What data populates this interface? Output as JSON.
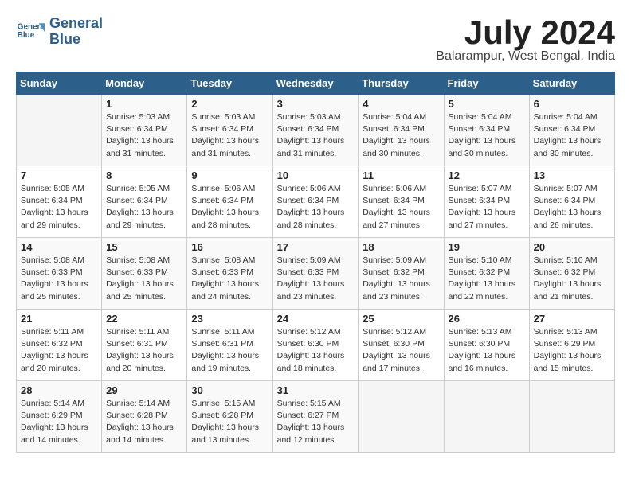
{
  "header": {
    "logo_line1": "General",
    "logo_line2": "Blue",
    "title": "July 2024",
    "location": "Balarampur, West Bengal, India"
  },
  "days_of_week": [
    "Sunday",
    "Monday",
    "Tuesday",
    "Wednesday",
    "Thursday",
    "Friday",
    "Saturday"
  ],
  "weeks": [
    [
      {
        "num": "",
        "info": ""
      },
      {
        "num": "1",
        "info": "Sunrise: 5:03 AM\nSunset: 6:34 PM\nDaylight: 13 hours\nand 31 minutes."
      },
      {
        "num": "2",
        "info": "Sunrise: 5:03 AM\nSunset: 6:34 PM\nDaylight: 13 hours\nand 31 minutes."
      },
      {
        "num": "3",
        "info": "Sunrise: 5:03 AM\nSunset: 6:34 PM\nDaylight: 13 hours\nand 31 minutes."
      },
      {
        "num": "4",
        "info": "Sunrise: 5:04 AM\nSunset: 6:34 PM\nDaylight: 13 hours\nand 30 minutes."
      },
      {
        "num": "5",
        "info": "Sunrise: 5:04 AM\nSunset: 6:34 PM\nDaylight: 13 hours\nand 30 minutes."
      },
      {
        "num": "6",
        "info": "Sunrise: 5:04 AM\nSunset: 6:34 PM\nDaylight: 13 hours\nand 30 minutes."
      }
    ],
    [
      {
        "num": "7",
        "info": "Sunrise: 5:05 AM\nSunset: 6:34 PM\nDaylight: 13 hours\nand 29 minutes."
      },
      {
        "num": "8",
        "info": "Sunrise: 5:05 AM\nSunset: 6:34 PM\nDaylight: 13 hours\nand 29 minutes."
      },
      {
        "num": "9",
        "info": "Sunrise: 5:06 AM\nSunset: 6:34 PM\nDaylight: 13 hours\nand 28 minutes."
      },
      {
        "num": "10",
        "info": "Sunrise: 5:06 AM\nSunset: 6:34 PM\nDaylight: 13 hours\nand 28 minutes."
      },
      {
        "num": "11",
        "info": "Sunrise: 5:06 AM\nSunset: 6:34 PM\nDaylight: 13 hours\nand 27 minutes."
      },
      {
        "num": "12",
        "info": "Sunrise: 5:07 AM\nSunset: 6:34 PM\nDaylight: 13 hours\nand 27 minutes."
      },
      {
        "num": "13",
        "info": "Sunrise: 5:07 AM\nSunset: 6:34 PM\nDaylight: 13 hours\nand 26 minutes."
      }
    ],
    [
      {
        "num": "14",
        "info": "Sunrise: 5:08 AM\nSunset: 6:33 PM\nDaylight: 13 hours\nand 25 minutes."
      },
      {
        "num": "15",
        "info": "Sunrise: 5:08 AM\nSunset: 6:33 PM\nDaylight: 13 hours\nand 25 minutes."
      },
      {
        "num": "16",
        "info": "Sunrise: 5:08 AM\nSunset: 6:33 PM\nDaylight: 13 hours\nand 24 minutes."
      },
      {
        "num": "17",
        "info": "Sunrise: 5:09 AM\nSunset: 6:33 PM\nDaylight: 13 hours\nand 23 minutes."
      },
      {
        "num": "18",
        "info": "Sunrise: 5:09 AM\nSunset: 6:32 PM\nDaylight: 13 hours\nand 23 minutes."
      },
      {
        "num": "19",
        "info": "Sunrise: 5:10 AM\nSunset: 6:32 PM\nDaylight: 13 hours\nand 22 minutes."
      },
      {
        "num": "20",
        "info": "Sunrise: 5:10 AM\nSunset: 6:32 PM\nDaylight: 13 hours\nand 21 minutes."
      }
    ],
    [
      {
        "num": "21",
        "info": "Sunrise: 5:11 AM\nSunset: 6:32 PM\nDaylight: 13 hours\nand 20 minutes."
      },
      {
        "num": "22",
        "info": "Sunrise: 5:11 AM\nSunset: 6:31 PM\nDaylight: 13 hours\nand 20 minutes."
      },
      {
        "num": "23",
        "info": "Sunrise: 5:11 AM\nSunset: 6:31 PM\nDaylight: 13 hours\nand 19 minutes."
      },
      {
        "num": "24",
        "info": "Sunrise: 5:12 AM\nSunset: 6:30 PM\nDaylight: 13 hours\nand 18 minutes."
      },
      {
        "num": "25",
        "info": "Sunrise: 5:12 AM\nSunset: 6:30 PM\nDaylight: 13 hours\nand 17 minutes."
      },
      {
        "num": "26",
        "info": "Sunrise: 5:13 AM\nSunset: 6:30 PM\nDaylight: 13 hours\nand 16 minutes."
      },
      {
        "num": "27",
        "info": "Sunrise: 5:13 AM\nSunset: 6:29 PM\nDaylight: 13 hours\nand 15 minutes."
      }
    ],
    [
      {
        "num": "28",
        "info": "Sunrise: 5:14 AM\nSunset: 6:29 PM\nDaylight: 13 hours\nand 14 minutes."
      },
      {
        "num": "29",
        "info": "Sunrise: 5:14 AM\nSunset: 6:28 PM\nDaylight: 13 hours\nand 14 minutes."
      },
      {
        "num": "30",
        "info": "Sunrise: 5:15 AM\nSunset: 6:28 PM\nDaylight: 13 hours\nand 13 minutes."
      },
      {
        "num": "31",
        "info": "Sunrise: 5:15 AM\nSunset: 6:27 PM\nDaylight: 13 hours\nand 12 minutes."
      },
      {
        "num": "",
        "info": ""
      },
      {
        "num": "",
        "info": ""
      },
      {
        "num": "",
        "info": ""
      }
    ]
  ]
}
